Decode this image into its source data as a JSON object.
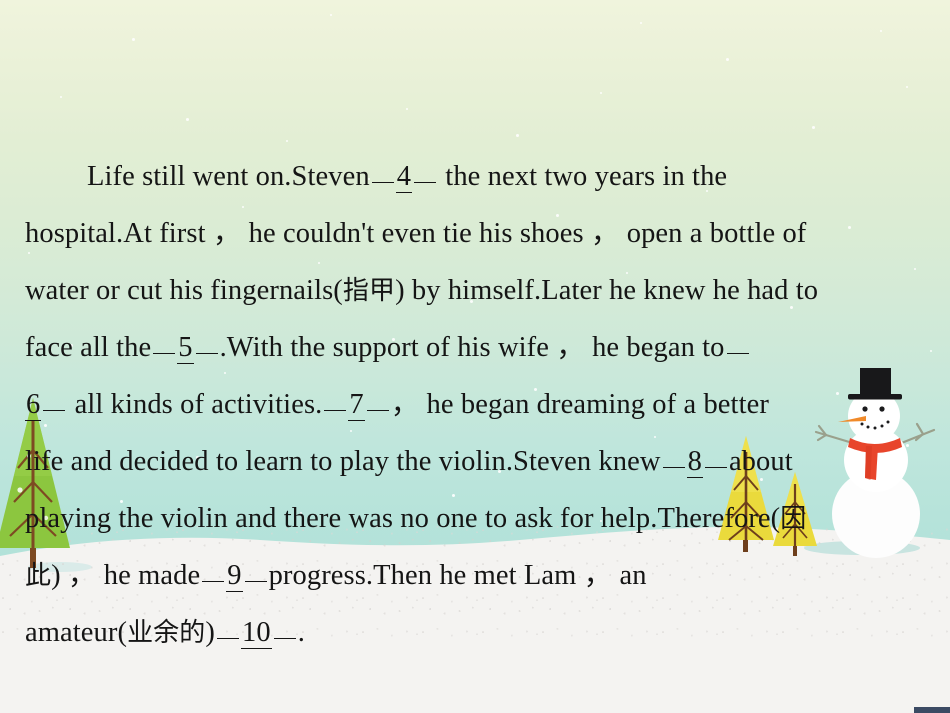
{
  "slide": {
    "type": "presentation-slide",
    "background": {
      "sky_top_color": "#f0f4dd",
      "sky_bottom_color": "#b2e2d9",
      "snow_color": "#f4f3f1",
      "theme": "winter-snow-scene"
    }
  },
  "passage": {
    "lines": [
      {
        "id": "line-1",
        "indent": true,
        "segments": [
          {
            "kind": "text",
            "value": "Life still went on.Steven"
          },
          {
            "kind": "blank",
            "value": "4"
          },
          {
            "kind": "text",
            "value": "the next two years in the"
          }
        ]
      },
      {
        "id": "line-2",
        "indent": false,
        "segments": [
          {
            "kind": "text",
            "value": "hospital.At first ， he couldn't even tie his shoes ， open a bottle of"
          }
        ]
      },
      {
        "id": "line-3",
        "indent": false,
        "segments": [
          {
            "kind": "text",
            "value": "water or cut his fingernails( "
          },
          {
            "kind": "cjk",
            "value": "指甲"
          },
          {
            "kind": "text",
            "value": " ) by himself.Later he knew he had to"
          }
        ]
      },
      {
        "id": "line-4",
        "indent": false,
        "segments": [
          {
            "kind": "text",
            "value": "face all the"
          },
          {
            "kind": "blank",
            "value": "5"
          },
          {
            "kind": "text",
            "value": ".With the support of his wife ， he began to"
          },
          {
            "kind": "half-blank-right",
            "value": ""
          }
        ]
      },
      {
        "id": "line-5",
        "indent": false,
        "segments": [
          {
            "kind": "half-blank-left",
            "value": "6"
          },
          {
            "kind": "text",
            "value": "all kinds of activities."
          },
          {
            "kind": "blank",
            "value": "7"
          },
          {
            "kind": "text",
            "value": "， he began dreaming of a better"
          }
        ]
      },
      {
        "id": "line-6",
        "indent": false,
        "segments": [
          {
            "kind": "text",
            "value": "life and decided to learn to play the violin.Steven knew"
          },
          {
            "kind": "blank",
            "value": "8"
          },
          {
            "kind": "text",
            "value": "about"
          }
        ]
      },
      {
        "id": "line-7",
        "indent": false,
        "segments": [
          {
            "kind": "text",
            "value": "playing the violin and there was no one to ask for help.Therefore( "
          },
          {
            "kind": "cjk",
            "value": "因"
          }
        ]
      },
      {
        "id": "line-8",
        "indent": false,
        "segments": [
          {
            "kind": "cjk",
            "value": "此"
          },
          {
            "kind": "text",
            "value": " ) ， he made"
          },
          {
            "kind": "blank",
            "value": "9"
          },
          {
            "kind": "text",
            "value": "progress.Then he met Lam ， an"
          }
        ]
      },
      {
        "id": "line-9",
        "indent": false,
        "segments": [
          {
            "kind": "text",
            "value": "amateur( "
          },
          {
            "kind": "cjk",
            "value": "业余的"
          },
          {
            "kind": "text",
            "value": " )"
          },
          {
            "kind": "blank",
            "value": "10"
          },
          {
            "kind": "text",
            "value": "."
          }
        ]
      }
    ],
    "blank_numbers": [
      "4",
      "5",
      "6",
      "7",
      "8",
      "9",
      "10"
    ],
    "line_1_prefix": "Life still went on.Steven",
    "line_1_suffix": "the next two years in the",
    "line_1_blank": "4",
    "line_2": "hospital.At first ， he couldn't even tie his shoes ， open a bottle of",
    "line_3_a": "water or cut his fingernails(",
    "line_3_cjk": "指甲",
    "line_3_b": ") by himself.Later he knew he had to",
    "line_4_a": "face all the",
    "line_4_blank": "5",
    "line_4_b": ".With the support of his wife ， he began to",
    "line_5_blank": "6",
    "line_5_a": "all kinds of activities.",
    "line_5_blank2": "7",
    "line_5_b": "， he began dreaming of a better",
    "line_6_a": "life and decided to learn to play the violin.Steven knew",
    "line_6_blank": "8",
    "line_6_b": "about",
    "line_7_a": "playing the violin and there was no one to ask for help.Therefore(",
    "line_7_cjk": "因",
    "line_8_cjk": "此",
    "line_8_a": ") ， he made",
    "line_8_blank": "9",
    "line_8_b": "progress.Then he met Lam ， an",
    "line_9_a": "amateur(",
    "line_9_cjk": "业余的",
    "line_9_b": ")",
    "line_9_blank": "10",
    "line_9_c": "."
  },
  "decorations": {
    "snowman": {
      "name": "snowman",
      "hat_color": "#18181a",
      "nose_color": "#f08a2a",
      "scarf_color": "#e8452b",
      "body_color": "#ffffff"
    },
    "trees": [
      {
        "name": "green-pine-left",
        "color": "#8cc63f"
      },
      {
        "name": "yellow-pine-large",
        "color": "#eada3c"
      },
      {
        "name": "yellow-pine-small",
        "color": "#eada3c"
      }
    ]
  }
}
